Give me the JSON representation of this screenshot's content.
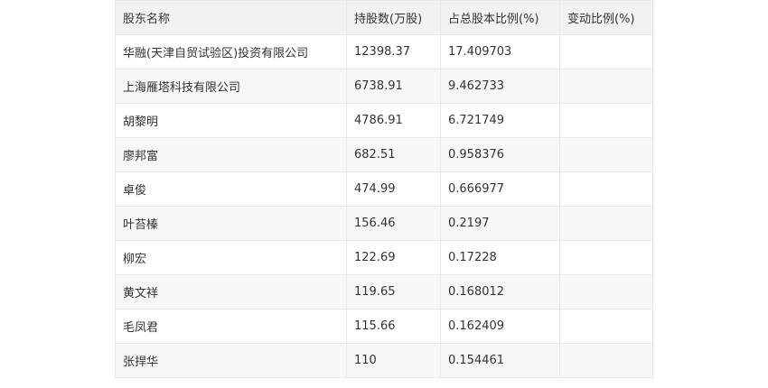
{
  "table": {
    "headers": [
      "股东名称",
      "持股数(万股)",
      "占总股本比例(%)",
      "变动比例(%)"
    ],
    "rows": [
      [
        "华融(天津自贸试验区)投资有限公司",
        "12398.37",
        "17.409703",
        ""
      ],
      [
        "上海雁塔科技有限公司",
        "6738.91",
        "9.462733",
        ""
      ],
      [
        "胡黎明",
        "4786.91",
        "6.721749",
        ""
      ],
      [
        "廖邦富",
        "682.51",
        "0.958376",
        ""
      ],
      [
        "卓俊",
        "474.99",
        "0.666977",
        ""
      ],
      [
        "叶苔榛",
        "156.46",
        "0.2197",
        ""
      ],
      [
        "柳宏",
        "122.69",
        "0.17228",
        ""
      ],
      [
        "黄文祥",
        "119.65",
        "0.168012",
        ""
      ],
      [
        "毛凤君",
        "115.66",
        "0.162409",
        ""
      ],
      [
        "张捍华",
        "110",
        "0.154461",
        ""
      ]
    ]
  }
}
